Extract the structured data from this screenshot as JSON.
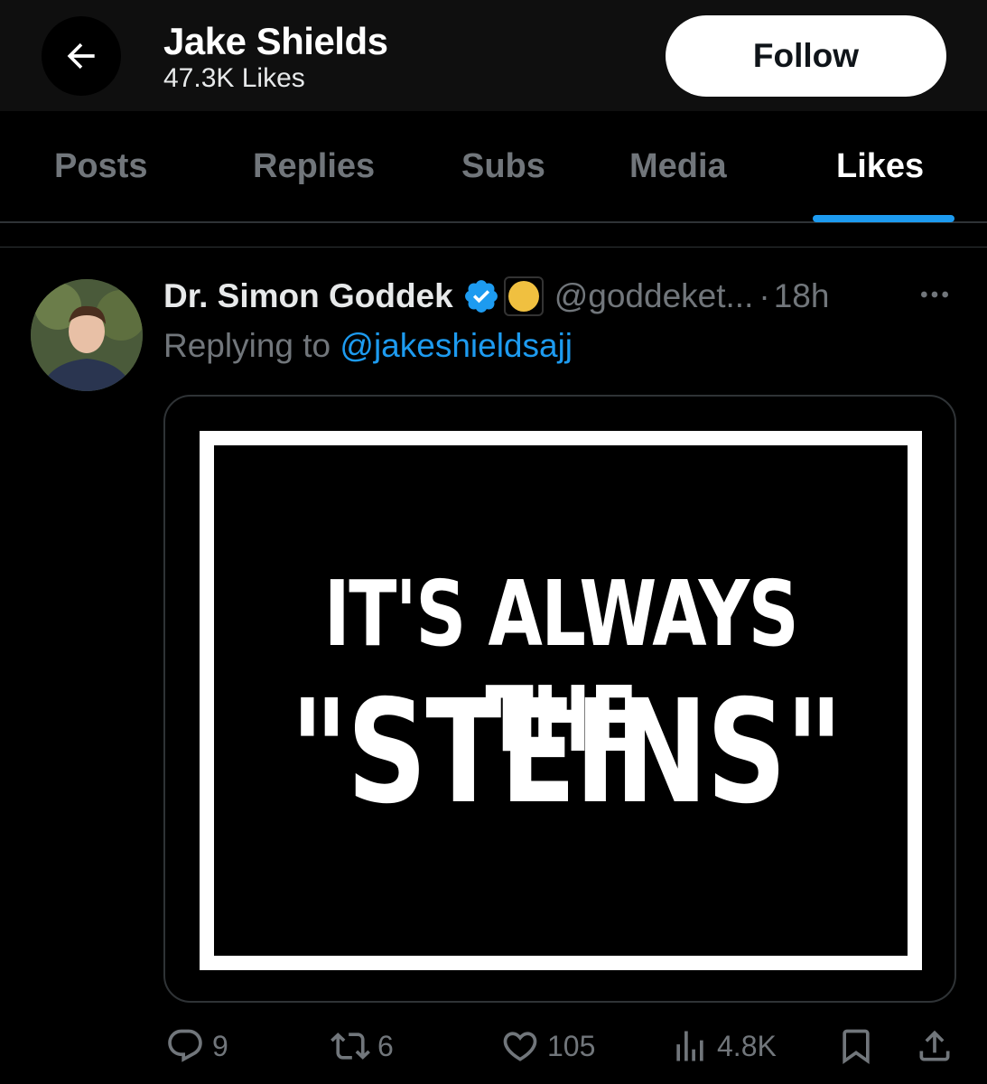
{
  "header": {
    "title": "Jake Shields",
    "subtitle": "47.3K Likes",
    "follow_label": "Follow"
  },
  "tabs": [
    {
      "label": "Posts",
      "active": false
    },
    {
      "label": "Replies",
      "active": false
    },
    {
      "label": "Subs",
      "active": false
    },
    {
      "label": "Media",
      "active": false
    },
    {
      "label": "Likes",
      "active": true
    }
  ],
  "tweet": {
    "author_name": "Dr. Simon Goddek",
    "handle": "@goddeket...",
    "separator": "·",
    "time": "18h",
    "replying_prefix": "Replying to",
    "replying_handle": "@jakeshieldsajj",
    "image_text_line1": "IT'S ALWAYS THE",
    "image_text_line2": "\"STEINS\"",
    "stats": {
      "replies": "9",
      "reposts": "6",
      "likes": "105",
      "views": "4.8K"
    }
  },
  "colors": {
    "accent": "#1d9bf0",
    "muted_text": "#71767b",
    "background": "#000000"
  },
  "icons": {
    "back": "arrow-left-icon",
    "verified": "verified-badge-icon",
    "more": "more-horizontal-icon",
    "reply": "reply-icon",
    "repost": "repost-icon",
    "like": "heart-icon",
    "views": "views-icon",
    "bookmark": "bookmark-icon",
    "share": "share-icon"
  }
}
